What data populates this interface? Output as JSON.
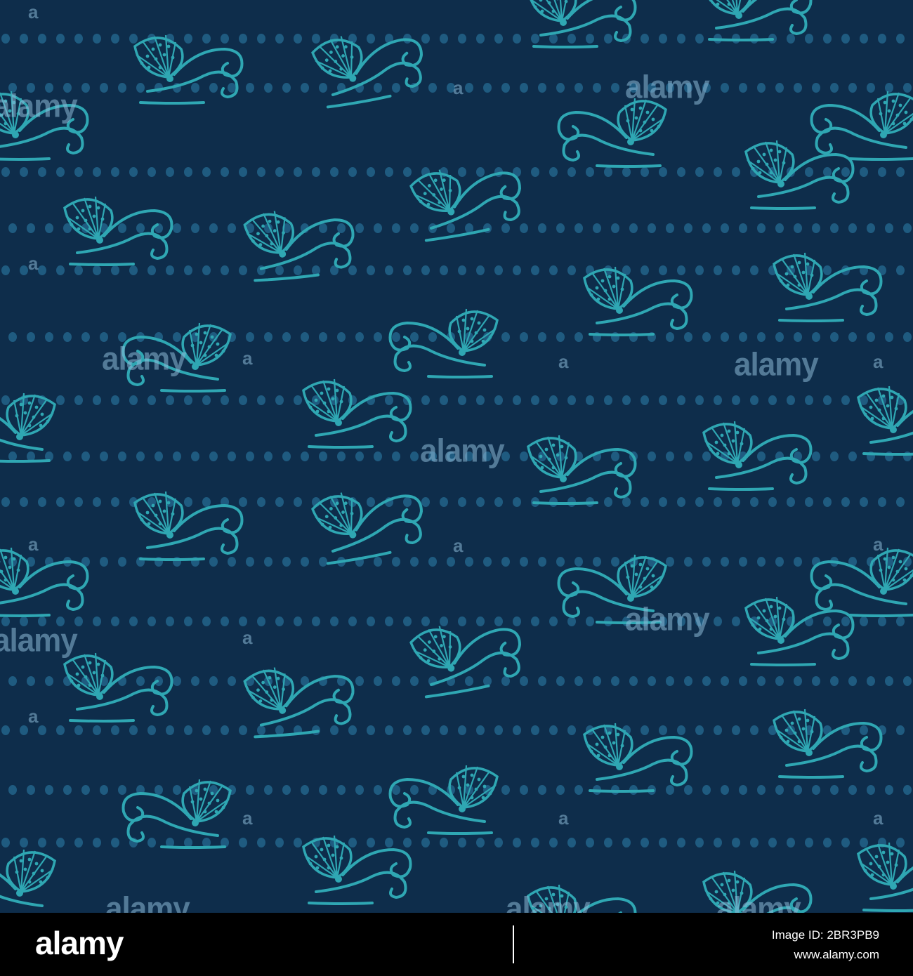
{
  "pattern": {
    "background_color": "#0e2d4b",
    "motif_color": "#2fa7b3",
    "dot_color": "#1f5b80",
    "motif": "seashell-with-waves-icon"
  },
  "watermark": {
    "text": "alamy",
    "glyph": "a"
  },
  "footer": {
    "logo": "alamy",
    "image_id": "Image ID: 2BR3PB9",
    "url": "www.alamy.com"
  }
}
